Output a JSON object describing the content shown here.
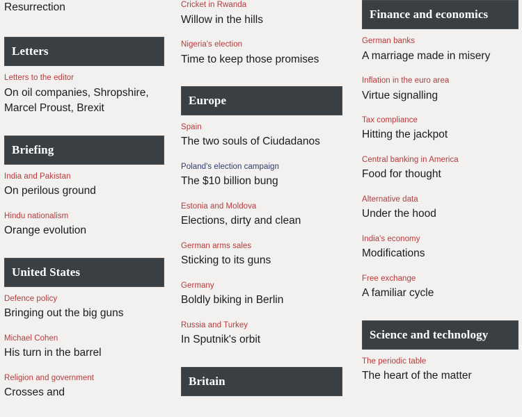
{
  "page": {
    "background_color": "#f2f1ef",
    "header_bar_color": "#3a3f44",
    "header_text_color": "#ffffff",
    "kicker_color": "#b53a3c",
    "kicker_visited_color": "#2e3a6b",
    "headline_color": "#1b1b1b"
  },
  "columns": [
    {
      "name": "column-left",
      "top_orphan_headline": "Resurrection",
      "sections": [
        {
          "title": "Letters",
          "articles": [
            {
              "kicker": "Letters to the editor",
              "headline": "On oil companies, Shropshire, Marcel Proust, Brexit",
              "visited": false
            }
          ]
        },
        {
          "title": "Briefing",
          "articles": [
            {
              "kicker": "India and Pakistan",
              "headline": "On perilous ground",
              "visited": false
            },
            {
              "kicker": "Hindu nationalism",
              "headline": "Orange evolution",
              "visited": false
            }
          ]
        },
        {
          "title": "United States",
          "articles": [
            {
              "kicker": "Defence policy",
              "headline": "Bringing out the big guns",
              "visited": false
            },
            {
              "kicker": "Michael Cohen",
              "headline": "His turn in the barrel",
              "visited": false
            },
            {
              "kicker": "Religion and government",
              "headline": "Crosses and",
              "visited": false
            }
          ]
        }
      ]
    },
    {
      "name": "column-middle",
      "top_articles": [
        {
          "kicker": "Cricket in Rwanda",
          "headline": "Willow in the hills",
          "visited": false
        },
        {
          "kicker": "Nigeria's election",
          "headline": "Time to keep those promises",
          "visited": false
        }
      ],
      "sections": [
        {
          "title": "Europe",
          "articles": [
            {
              "kicker": "Spain",
              "headline": "The two souls of Ciudadanos",
              "visited": false
            },
            {
              "kicker": "Poland's election campaign",
              "headline": "The $10 billion bung",
              "visited": true
            },
            {
              "kicker": "Estonia and Moldova",
              "headline": "Elections, dirty and clean",
              "visited": false
            },
            {
              "kicker": "German arms sales",
              "headline": "Sticking to its guns",
              "visited": false
            },
            {
              "kicker": "Germany",
              "headline": "Boldly biking in Berlin",
              "visited": false
            },
            {
              "kicker": "Russia and Turkey",
              "headline": "In Sputnik's orbit",
              "visited": false
            }
          ]
        },
        {
          "title": "Britain",
          "articles": []
        }
      ]
    },
    {
      "name": "column-right",
      "sections": [
        {
          "title": "Finance and economics",
          "articles": [
            {
              "kicker": "German banks",
              "headline": "A marriage made in misery",
              "visited": false
            },
            {
              "kicker": "Inflation in the euro area",
              "headline": "Virtue signalling",
              "visited": false
            },
            {
              "kicker": "Tax compliance",
              "headline": "Hitting the jackpot",
              "visited": false
            },
            {
              "kicker": "Central banking in America",
              "headline": "Food for thought",
              "visited": false
            },
            {
              "kicker": "Alternative data",
              "headline": "Under the hood",
              "visited": false
            },
            {
              "kicker": "India's economy",
              "headline": "Modifications",
              "visited": false
            },
            {
              "kicker": "Free exchange",
              "headline": "A familiar cycle",
              "visited": false
            }
          ]
        },
        {
          "title": "Science and technology",
          "articles": [
            {
              "kicker": "The periodic table",
              "headline": "The heart of the matter",
              "visited": false
            }
          ]
        }
      ]
    }
  ]
}
